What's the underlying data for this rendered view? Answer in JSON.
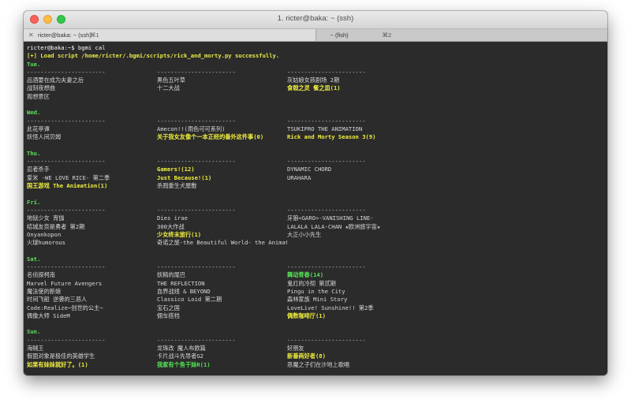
{
  "window": {
    "title": "1. ricter@baka: ~ (ssh)",
    "tabs": [
      {
        "close": "✕",
        "label": "ricter@baka: ~ (ssh)",
        "shortcut": "⌘1"
      },
      {
        "close": "",
        "label": "~ (fish)",
        "shortcut": "⌘2"
      }
    ]
  },
  "terminal": {
    "prompt": "ricter@baka:~$ bgmi cal",
    "load_msg": "[+] Load script /home/ricter/.bgmi/scripts/rick_and_morty.py successfully.",
    "separator": "-----------------------",
    "days": [
      {
        "name": "Tue.",
        "rows": [
          [
            {
              "t": "品酒要在成为夫妻之后",
              "c": "w"
            },
            {
              "t": "黑色五叶草",
              "c": "w"
            },
            {
              "t": "灰姑娘女孩剧场 2期",
              "c": "w"
            }
          ],
          [
            {
              "t": "战刻夜想曲",
              "c": "w"
            },
            {
              "t": "十二大战",
              "c": "w"
            },
            {
              "t": "食戟之灵 餐之皿(1)",
              "c": "y"
            }
          ],
          [
            {
              "t": "观想景区",
              "c": "w"
            },
            {
              "t": "",
              "c": "w"
            },
            {
              "t": "",
              "c": "w"
            }
          ]
        ]
      },
      {
        "name": "Wed.",
        "rows": [
          [
            {
              "t": "此花亭谭",
              "c": "w"
            },
            {
              "t": "Amecon!!(雨色可可系列)",
              "c": "w"
            },
            {
              "t": "TSUKIPRO THE ANIMATION",
              "c": "w"
            }
          ],
          [
            {
              "t": "妖怪人间贝姆",
              "c": "w"
            },
            {
              "t": "关于我女友像个一本正经的番外这件事(0)",
              "c": "y"
            },
            {
              "t": "Rick and Morty Season 3(9)",
              "c": "y"
            }
          ]
        ]
      },
      {
        "name": "Thu.",
        "rows": [
          [
            {
              "t": "忍者杀手",
              "c": "w"
            },
            {
              "t": "Gamers!(12)",
              "c": "y"
            },
            {
              "t": "DYNAMIC CHORD",
              "c": "w"
            }
          ],
          [
            {
              "t": "爱米 -WE LOVE RICE- 第二季",
              "c": "w"
            },
            {
              "t": "Just Because!(1)",
              "c": "y"
            },
            {
              "t": "URAHARA",
              "c": "w"
            }
          ],
          [
            {
              "t": "国王游戏 The Animation(1)",
              "c": "y"
            },
            {
              "t": "杀戮重生犬屋敷",
              "c": "w"
            },
            {
              "t": "",
              "c": "w"
            }
          ]
        ]
      },
      {
        "name": "Fri.",
        "rows": [
          [
            {
              "t": "地狱少女 宵伽",
              "c": "w"
            },
            {
              "t": "Dies irae",
              "c": "w"
            },
            {
              "t": "牙狼<GARO>-VANISHING LINE-",
              "c": "w"
            }
          ],
          [
            {
              "t": "结城友奈是勇者 第2期",
              "c": "w"
            },
            {
              "t": "300大作战",
              "c": "w"
            },
            {
              "t": "LALALA LALA-CHAN ★欧洲旅宇宙★",
              "c": "w"
            }
          ],
          [
            {
              "t": "Onyankopon",
              "c": "w"
            },
            {
              "t": "少女终末旅行(1)",
              "c": "y"
            },
            {
              "t": "大正小小先生",
              "c": "w"
            }
          ],
          [
            {
              "t": "火球humorous",
              "c": "w"
            },
            {
              "t": "奇诺之旅-the Beautiful World- the Animated Series  梦之祭!R",
              "c": "w"
            },
            {
              "t": "",
              "c": "w"
            }
          ]
        ]
      },
      {
        "name": "Sat.",
        "rows": [
          [
            {
              "t": "名侦探柯南",
              "c": "w"
            },
            {
              "t": "妖精的尾巴",
              "c": "w"
            },
            {
              "t": "舞动青春(14)",
              "c": "g"
            }
          ],
          [
            {
              "t": "Marvel Future Avengers",
              "c": "w"
            },
            {
              "t": "THE REFLECTION",
              "c": "w"
            },
            {
              "t": "鬼灯的冷彻 第贰期",
              "c": "w"
            }
          ],
          [
            {
              "t": "魔法使的新娘",
              "c": "w"
            },
            {
              "t": "血界战线 & BEYOND",
              "c": "w"
            },
            {
              "t": "Pingu in the City",
              "c": "w"
            }
          ],
          [
            {
              "t": "时间飞船 逆袭的三恶人",
              "c": "w"
            },
            {
              "t": "Classico Loid 第二期",
              "c": "w"
            },
            {
              "t": "森林家族 Mini Story",
              "c": "w"
            }
          ],
          [
            {
              "t": "Code:Realize~创世的公主~",
              "c": "w"
            },
            {
              "t": "宝石之国",
              "c": "w"
            },
            {
              "t": "LoveLive! Sunshine!! 第2季",
              "c": "w"
            }
          ],
          [
            {
              "t": "偶像大师 SideM",
              "c": "w"
            },
            {
              "t": "佣车搭档",
              "c": "w"
            },
            {
              "t": "偶数咖啡厅(1)",
              "c": "y"
            }
          ]
        ]
      },
      {
        "name": "Sun.",
        "rows": [
          [
            {
              "t": "海贼王",
              "c": "w"
            },
            {
              "t": "龙珠改 魔人布欧篇",
              "c": "w"
            },
            {
              "t": "好朋友",
              "c": "w"
            }
          ],
          [
            {
              "t": "假面对象是极佳的英雄学生",
              "c": "w"
            },
            {
              "t": "卡片战斗先导者G2",
              "c": "w"
            },
            {
              "t": "新番两好者(8)",
              "c": "y"
            }
          ],
          [
            {
              "t": "如果有妹妹就好了。(1)",
              "c": "y"
            },
            {
              "t": "我家有个鱼干妹R(1)",
              "c": "g"
            },
            {
              "t": "恶魔之子们在沙地上歌唱",
              "c": "w"
            }
          ]
        ]
      },
      {
        "name": "Mon.",
        "rows": [
          [
            {
              "t": "偶像活动",
              "c": "w"
            },
            {
              "t": "Dia Horizon",
              "c": "w"
            },
            {
              "t": "阿松 第2期",
              "c": "w"
            }
          ],
          [
            {
              "t": "Infini-T Force",
              "c": "w"
            },
            {
              "t": "UQ HOLDER! ～魔法老师! 2～",
              "c": "w"
            },
            {
              "t": "奇跡批判组(0)",
              "c": "y"
            }
          ],
          [
            {
              "t": "Wake Up, Girls! 新章",
              "c": "w"
            },
            {
              "t": "",
              "c": "w"
            },
            {
              "t": "",
              "c": "w"
            }
          ]
        ]
      }
    ]
  }
}
